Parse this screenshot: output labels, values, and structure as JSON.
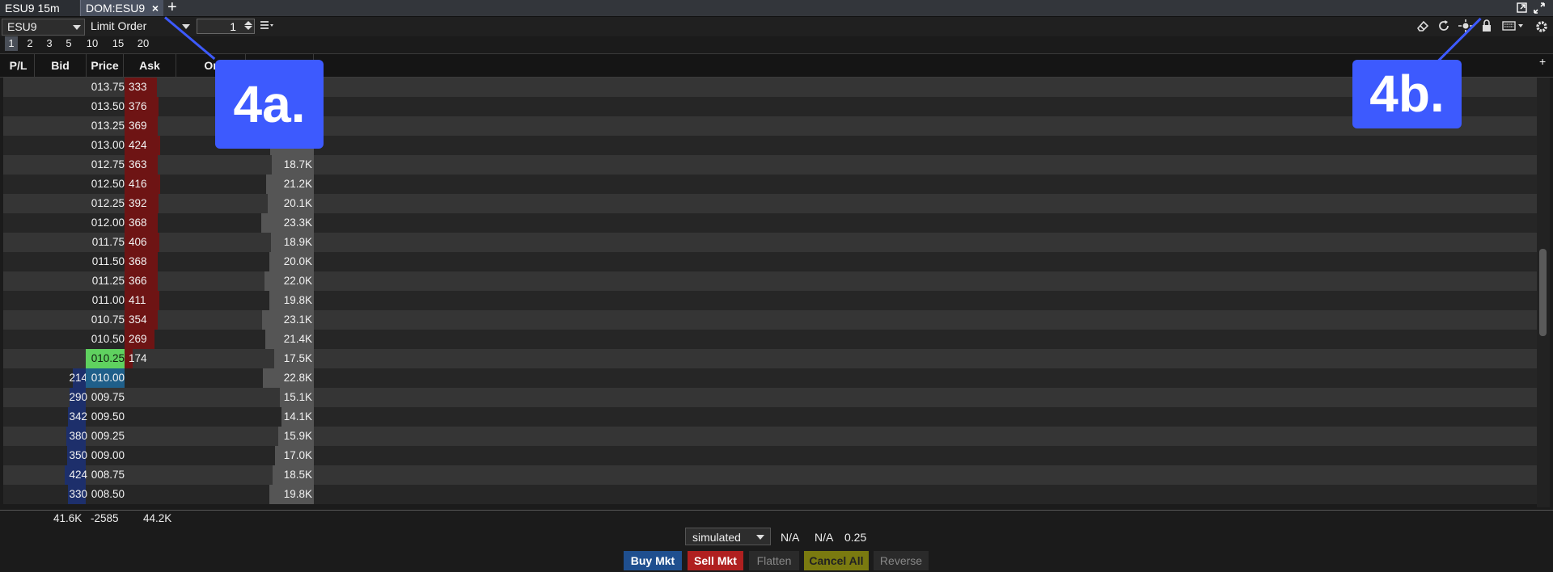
{
  "tabs": [
    {
      "label": "ESU9 15m"
    },
    {
      "label": "DOM:ESU9",
      "close": "×"
    }
  ],
  "tab_add": "+",
  "window_icons": [
    "popout-icon",
    "expand-icon"
  ],
  "toolbar": {
    "symbol": "ESU9",
    "order_type": "Limit Order",
    "quantity": "1",
    "icons": [
      "list-menu-icon",
      "eraser-icon",
      "refresh-icon",
      "center-icon",
      "lock-icon",
      "keyboard-icon",
      "settings-icon"
    ]
  },
  "depth_levels": [
    "1",
    "2",
    "3",
    "5",
    "10",
    "15",
    "20"
  ],
  "depth_selected": "1",
  "headers": {
    "pl": "P/L",
    "bid": "Bid",
    "price": "Price",
    "ask": "Ask",
    "orders": "Or"
  },
  "rows": [
    {
      "bid": "",
      "price": "013.75",
      "ask": "333",
      "vol": ""
    },
    {
      "bid": "",
      "price": "013.50",
      "ask": "376",
      "vol": ""
    },
    {
      "bid": "",
      "price": "013.25",
      "ask": "369",
      "vol": ""
    },
    {
      "bid": "",
      "price": "013.00",
      "ask": "424",
      "vol": ""
    },
    {
      "bid": "",
      "price": "012.75",
      "ask": "363",
      "vol": "18.7K"
    },
    {
      "bid": "",
      "price": "012.50",
      "ask": "416",
      "vol": "21.2K"
    },
    {
      "bid": "",
      "price": "012.25",
      "ask": "392",
      "vol": "20.1K"
    },
    {
      "bid": "",
      "price": "012.00",
      "ask": "368",
      "vol": "23.3K"
    },
    {
      "bid": "",
      "price": "011.75",
      "ask": "406",
      "vol": "18.9K"
    },
    {
      "bid": "",
      "price": "011.50",
      "ask": "368",
      "vol": "20.0K"
    },
    {
      "bid": "",
      "price": "011.25",
      "ask": "366",
      "vol": "22.0K"
    },
    {
      "bid": "",
      "price": "011.00",
      "ask": "411",
      "vol": "19.8K"
    },
    {
      "bid": "",
      "price": "010.75",
      "ask": "354",
      "vol": "23.1K"
    },
    {
      "bid": "",
      "price": "010.50",
      "ask": "269",
      "vol": "21.4K"
    },
    {
      "bid": "",
      "price": "010.25",
      "ask": "174",
      "vol": "17.5K",
      "last": true
    },
    {
      "bid": "214",
      "price": "010.00",
      "ask": "",
      "vol": "22.8K",
      "best_bid": true
    },
    {
      "bid": "290",
      "price": "009.75",
      "ask": "",
      "vol": "15.1K"
    },
    {
      "bid": "342",
      "price": "009.50",
      "ask": "",
      "vol": "14.1K"
    },
    {
      "bid": "380",
      "price": "009.25",
      "ask": "",
      "vol": "15.9K"
    },
    {
      "bid": "350",
      "price": "009.00",
      "ask": "",
      "vol": "17.0K"
    },
    {
      "bid": "424",
      "price": "008.75",
      "ask": "",
      "vol": "18.5K"
    },
    {
      "bid": "330",
      "price": "008.50",
      "ask": "",
      "vol": "19.8K"
    }
  ],
  "vol_levels": [
    0.78,
    0.76,
    0.77,
    0.75,
    0.72,
    0.82,
    0.79,
    0.9,
    0.73,
    0.77,
    0.85,
    0.77,
    0.89,
    0.83,
    0.68,
    0.88,
    0.58,
    0.55,
    0.61,
    0.66,
    0.71,
    0.77
  ],
  "totals": {
    "bid": "41.6K",
    "price": "-2585",
    "ask": "44.2K"
  },
  "footer": {
    "account": "simulated",
    "stat1": "N/A",
    "stat2": "N/A",
    "tick": "0.25",
    "buy": "Buy Mkt",
    "sell": "Sell Mkt",
    "flatten": "Flatten",
    "cancel": "Cancel All",
    "reverse": "Reverse"
  },
  "annotations": {
    "a": "4a.",
    "b": "4b."
  },
  "colors": {
    "bid_bar": "#1d2f6b",
    "ask_bar": "#6e1414",
    "last_price": "#5fd15f",
    "best_bid": "#1f5f8a",
    "buy": "#1f4f8f",
    "sell": "#b02020",
    "cancel": "#7a7a10",
    "callout": "#3d5afe"
  }
}
